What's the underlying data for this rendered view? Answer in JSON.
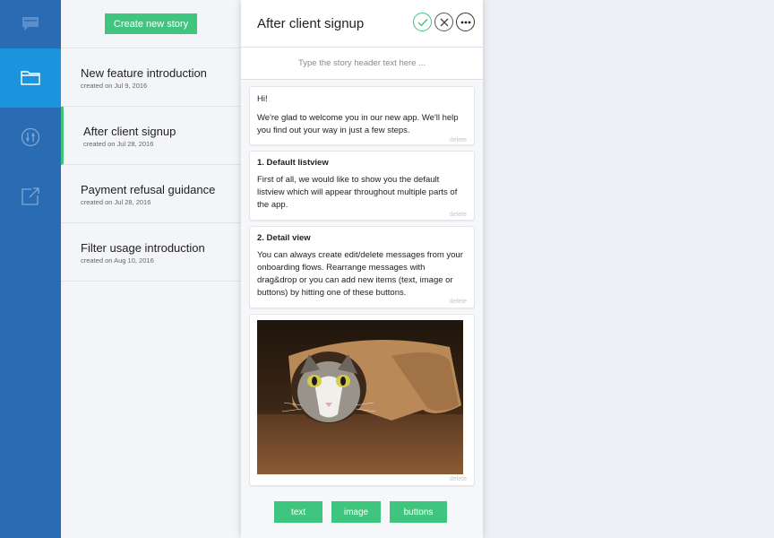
{
  "rail": {
    "icons": [
      "chat-logo-icon",
      "folder-icon",
      "sliders-icon",
      "external-link-icon"
    ],
    "active_index": 1
  },
  "list": {
    "create_label": "Create new story",
    "stories": [
      {
        "title": "New feature introduction",
        "date": "created on Jul 9, 2016"
      },
      {
        "title": "After client signup",
        "date": "created on Jul 28, 2016"
      },
      {
        "title": "Payment refusal guidance",
        "date": "created on Jul 28, 2016"
      },
      {
        "title": "Filter usage introduction",
        "date": "created on Aug 10, 2016"
      }
    ],
    "active_index": 1
  },
  "editor": {
    "title": "After client signup",
    "header_placeholder": "Type the story header text here ...",
    "messages": [
      {
        "heading": "Hi!",
        "body": "We're glad to welcome you in our new app. We'll help you find out your way in just a few steps.",
        "delete_label": "delete"
      },
      {
        "heading": "1. Default listview",
        "body": "First of all, we would like to show you the default listview which will appear throughout multiple parts of the app.",
        "delete_label": "delete"
      },
      {
        "heading": "2. Detail view",
        "body": "You can always create edit/delete messages from your onboarding flows. Rearrange messages with drag&drop or you can add new items (text, image or buttons) by hitting one of these buttons.",
        "delete_label": "delete"
      }
    ],
    "image_card": {
      "delete_label": "delete"
    },
    "add_buttons": {
      "text": "text",
      "image": "image",
      "buttons": "buttons"
    }
  },
  "colors": {
    "accent": "#3fc57e",
    "rail": "#2a6cb3",
    "rail_active": "#1b93dd"
  }
}
